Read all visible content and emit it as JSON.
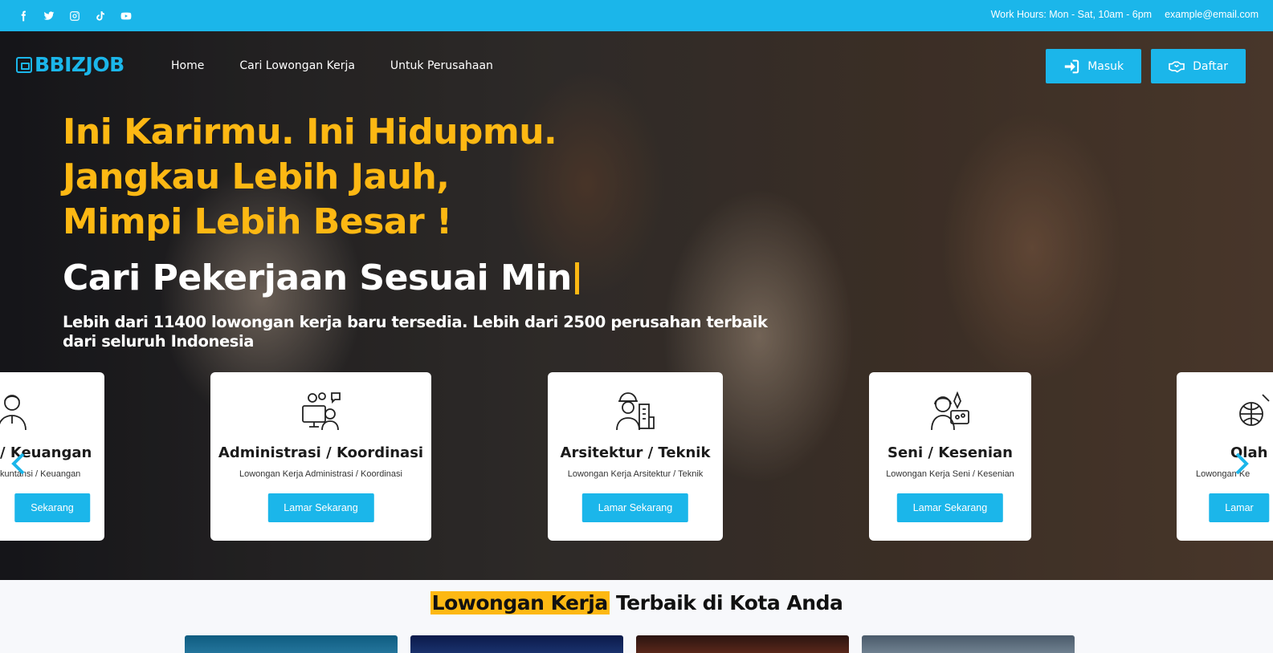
{
  "topbar": {
    "social_icons": [
      "facebook-icon",
      "twitter-icon",
      "instagram-icon",
      "tiktok-icon",
      "youtube-icon"
    ],
    "work_hours": "Work Hours: Mon - Sat, 10am - 6pm",
    "email": "example@email.com"
  },
  "nav": {
    "logo": "BBIZJOB",
    "links": [
      "Home",
      "Cari Lowongan Kerja",
      "Untuk Perusahaan"
    ],
    "login_label": "Masuk",
    "register_label": "Daftar"
  },
  "hero": {
    "headline": [
      "Ini Karirmu. Ini Hidupmu.",
      "Jangkau Lebih Jauh,",
      "Mimpi Lebih Besar !"
    ],
    "typed_text": "Cari Pekerjaan Sesuai Min",
    "subtitle": "Lebih dari 11400 lowongan kerja baru tersedia. Lebih dari 2500 perusahan terbaik dari seluruh Indonesia"
  },
  "categories": [
    {
      "title": "/ Keuangan",
      "desc": "kuntansi / Keuangan",
      "button": "Sekarang",
      "icon": "accountant-icon"
    },
    {
      "title": "Administrasi / Koordinasi",
      "desc": "Lowongan Kerja Administrasi / Koordinasi",
      "button": "Lamar Sekarang",
      "icon": "admin-icon"
    },
    {
      "title": "Arsitektur / Teknik",
      "desc": "Lowongan Kerja Arsitektur / Teknik",
      "button": "Lamar Sekarang",
      "icon": "engineer-icon"
    },
    {
      "title": "Seni / Kesenian",
      "desc": "Lowongan Kerja Seni / Kesenian",
      "button": "Lamar Sekarang",
      "icon": "artist-icon"
    },
    {
      "title": "Olah",
      "desc": "Lowongan Ke",
      "button": "Lamar",
      "icon": "sports-icon"
    }
  ],
  "section": {
    "highlight": "Lowongan Kerja",
    "rest": " Terbaik di Kota Anda"
  },
  "colors": {
    "accent": "#1bb6ea",
    "highlight": "#fdb813"
  }
}
